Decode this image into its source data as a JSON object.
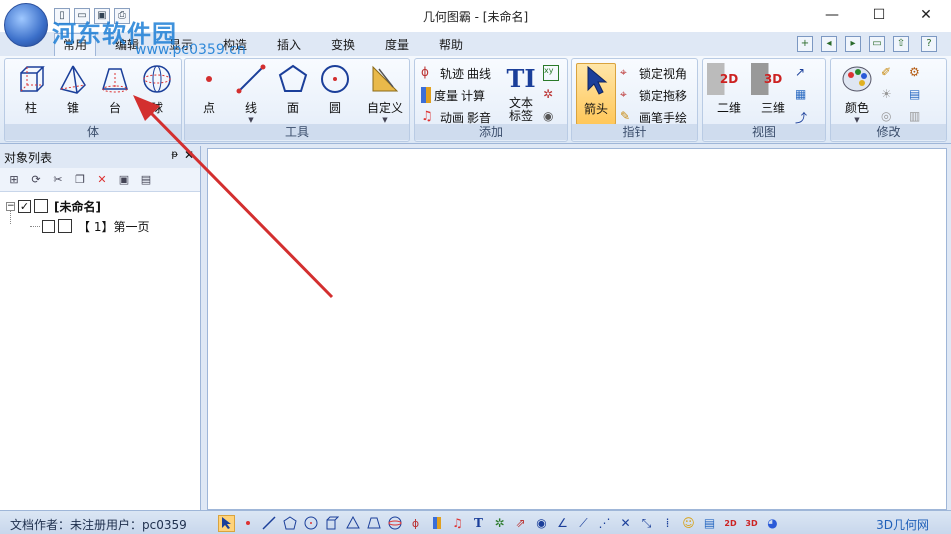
{
  "window": {
    "title": "几何图霸 - [未命名]",
    "minimize": "—",
    "maximize": "☐",
    "close": "✕"
  },
  "watermark": {
    "text": "河东软件园",
    "url": "www.pc0359.cn"
  },
  "menu": {
    "tabs": [
      "常用",
      "编辑",
      "显示",
      "构造",
      "插入",
      "变换",
      "度量",
      "帮助"
    ],
    "active_tab": "常用"
  },
  "ribbon": {
    "groups": {
      "solid": {
        "label": "体",
        "buttons": [
          "柱",
          "锥",
          "台",
          "球"
        ]
      },
      "tools": {
        "label": "工具",
        "buttons": [
          "点",
          "线",
          "面",
          "圆",
          "自定义"
        ]
      },
      "add": {
        "label": "添加",
        "small_buttons": [
          "轨迹",
          "曲线",
          "度量",
          "计算",
          "动画",
          "影音"
        ],
        "big_button": "文本标签",
        "big_icon_text": "TI"
      },
      "pointer": {
        "label": "指针",
        "big_button": "箭头",
        "small_buttons": [
          "锁定视角",
          "锁定拖移",
          "画笔手绘"
        ]
      },
      "view": {
        "label": "视图",
        "buttons": [
          "二维",
          "三维"
        ],
        "icon_2d": "2D",
        "icon_3d": "3D"
      },
      "modify": {
        "label": "修改",
        "big_button": "颜色"
      }
    }
  },
  "panel": {
    "title": "对象列表",
    "pin": "ᵽ",
    "close": "✕",
    "tree": {
      "root": "[未命名]",
      "child": "【 1】第一页"
    }
  },
  "status": {
    "text": "文档作者：未注册用户：pc0359",
    "site": "3D几何网"
  },
  "colors": {
    "accent": "#1e7fd6",
    "annotation_arrow": "#d32f2f",
    "ribbon_bg": "#dfe8f5"
  }
}
